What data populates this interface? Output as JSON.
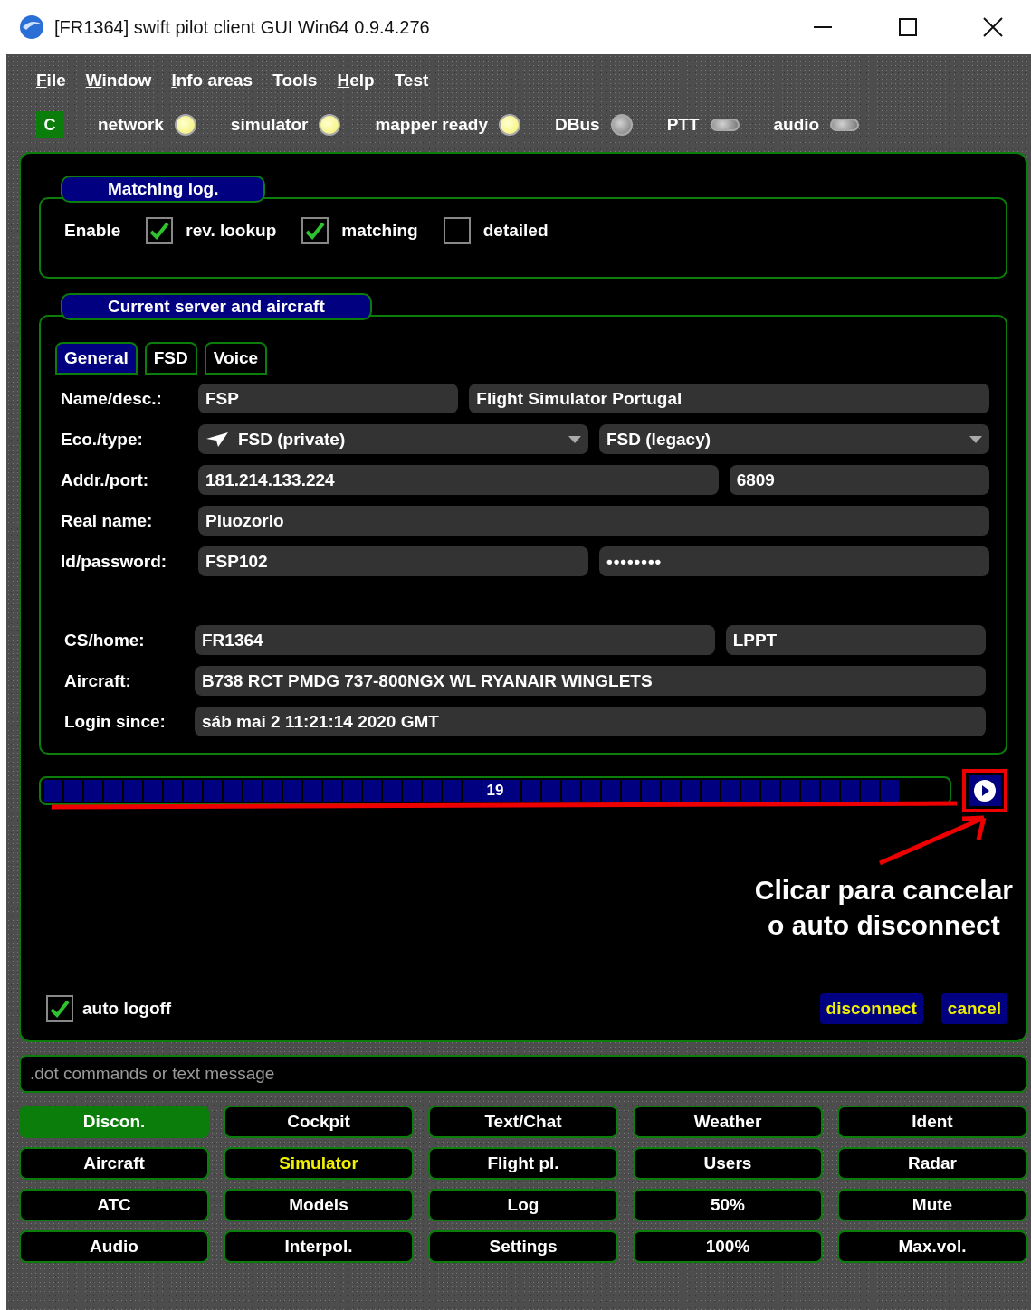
{
  "window": {
    "title": "[FR1364] swift pilot client GUI Win64 0.9.4.276"
  },
  "menu": [
    {
      "label": "File",
      "underlined": true
    },
    {
      "label": "Window",
      "underlined": true
    },
    {
      "label": "Info areas",
      "underlined": true
    },
    {
      "label": "Tools",
      "underlined": false
    },
    {
      "label": "Help",
      "underlined": true
    },
    {
      "label": "Test",
      "underlined": false
    }
  ],
  "status": {
    "badge": "C",
    "indicators": [
      {
        "label": "network",
        "kind": "round",
        "on": true
      },
      {
        "label": "simulator",
        "kind": "round",
        "on": true
      },
      {
        "label": "mapper ready",
        "kind": "round",
        "on": true
      },
      {
        "label": "DBus",
        "kind": "round",
        "on": false
      },
      {
        "label": "PTT",
        "kind": "pill",
        "on": false
      },
      {
        "label": "audio",
        "kind": "pill",
        "on": false
      }
    ]
  },
  "matching_log": {
    "title": "Matching log.",
    "label": "Enable",
    "options": [
      {
        "label": "rev. lookup",
        "checked": true
      },
      {
        "label": "matching",
        "checked": true
      },
      {
        "label": "detailed",
        "checked": false
      }
    ]
  },
  "server": {
    "title": "Current server and aircraft",
    "tabs": [
      {
        "label": "General",
        "selected": true
      },
      {
        "label": "FSD",
        "selected": false
      },
      {
        "label": "Voice",
        "selected": false
      }
    ],
    "account_rows": [
      {
        "label": "Name/desc.:",
        "fields": [
          {
            "kind": "text",
            "value": "FSP"
          },
          {
            "kind": "text",
            "value": "Flight Simulator Portugal"
          }
        ]
      },
      {
        "label": "Eco./type:",
        "fields": [
          {
            "kind": "icon-dropdown",
            "value": "FSD (private)"
          },
          {
            "kind": "dropdown",
            "value": "FSD (legacy)"
          }
        ]
      },
      {
        "label": "Addr./port:",
        "fields": [
          {
            "kind": "text",
            "value": "181.214.133.224"
          },
          {
            "kind": "text",
            "value": "6809"
          }
        ]
      },
      {
        "label": "Real name:",
        "fields": [
          {
            "kind": "text",
            "value": "Piuozorio"
          }
        ]
      },
      {
        "label": "Id/password:",
        "fields": [
          {
            "kind": "text",
            "value": "FSP102"
          },
          {
            "kind": "password",
            "value": "••••••••"
          }
        ]
      }
    ],
    "aircraft_rows": [
      {
        "label": "CS/home:",
        "fields": [
          {
            "kind": "text",
            "value": "FR1364"
          },
          {
            "kind": "text",
            "value": "LPPT"
          }
        ]
      },
      {
        "label": "Aircraft:",
        "fields": [
          {
            "kind": "text",
            "value": "B738 RCT PMDG 737-800NGX WL RYANAIR WINGLETS"
          }
        ]
      },
      {
        "label": "Login since:",
        "fields": [
          {
            "kind": "text",
            "value": "sáb mai 2 11:21:14 2020 GMT"
          }
        ]
      }
    ]
  },
  "countdown": {
    "level": 0.95,
    "reading": "19"
  },
  "annotation": {
    "lines": [
      "Clicar para cancelar",
      "o auto disconnect"
    ]
  },
  "auto_logoff": {
    "label": "auto logoff",
    "checked": true
  },
  "actions": [
    "disconnect",
    "cancel"
  ],
  "message_field": {
    "placeholder": ".dot commands or text message"
  },
  "nav_buttons": [
    {
      "label": "Discon.",
      "kind": "active"
    },
    {
      "label": "Cockpit",
      "kind": "normal"
    },
    {
      "label": "Text/Chat",
      "kind": "normal"
    },
    {
      "label": "Weather",
      "kind": "normal"
    },
    {
      "label": "Ident",
      "kind": "normal"
    },
    {
      "label": "Aircraft",
      "kind": "normal"
    },
    {
      "label": "Simulator",
      "kind": "highlight"
    },
    {
      "label": "Flight pl.",
      "kind": "normal"
    },
    {
      "label": "Users",
      "kind": "normal"
    },
    {
      "label": "Radar",
      "kind": "normal"
    },
    {
      "label": "ATC",
      "kind": "normal"
    },
    {
      "label": "Models",
      "kind": "normal"
    },
    {
      "label": "Log",
      "kind": "normal"
    },
    {
      "label": "50%",
      "kind": "normal"
    },
    {
      "label": "Mute",
      "kind": "normal"
    },
    {
      "label": "Audio",
      "kind": "normal"
    },
    {
      "label": "Interpol.",
      "kind": "normal"
    },
    {
      "label": "Settings",
      "kind": "normal"
    },
    {
      "label": "100%",
      "kind": "normal"
    },
    {
      "label": "Max.vol.",
      "kind": "normal"
    }
  ]
}
